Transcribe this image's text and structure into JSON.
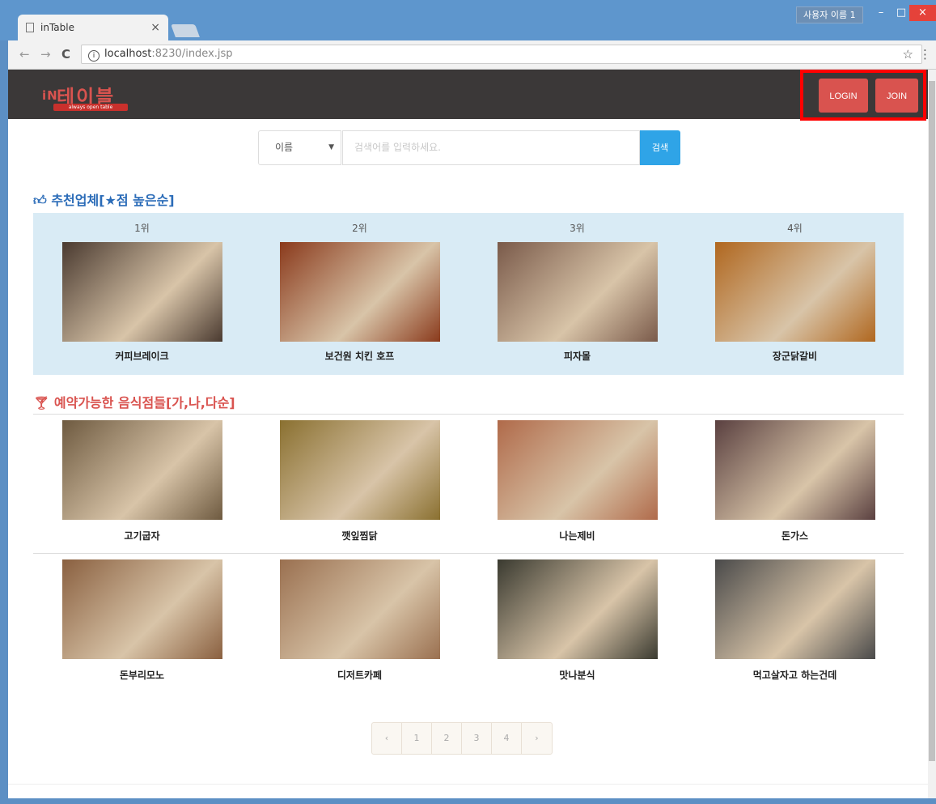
{
  "browser": {
    "tab_title": "inTable",
    "tab_close": "×",
    "user_badge": "사용자 이름 1",
    "win_min": "–",
    "win_max": "□",
    "win_close": "×",
    "url_host": "localhost",
    "url_rest": ":8230/index.jsp",
    "back": "←",
    "forward": "→",
    "reload": "C",
    "star": "☆",
    "menu": "⋮"
  },
  "header": {
    "logo_small": "iN",
    "logo_big": "테이블",
    "logo_tagline": "always open table",
    "login_label": "LOGIN",
    "join_label": "JOIN"
  },
  "search": {
    "select_value": "이름",
    "placeholder": "검색어를 입력하세요.",
    "button_label": "검색"
  },
  "recommended": {
    "title": "추천업체[★점 높은순]",
    "items": [
      {
        "rank": "1위",
        "name": "커피브레이크",
        "color": "#4a3a30"
      },
      {
        "rank": "2위",
        "name": "보건원 치킨 호프",
        "color": "#8a3a1c"
      },
      {
        "rank": "3위",
        "name": "피자몰",
        "color": "#7a5a4a"
      },
      {
        "rank": "4위",
        "name": "장군닭갈비",
        "color": "#b0671f"
      }
    ]
  },
  "reservable": {
    "title": "예약가능한 음식점들[가,나,다순]",
    "row1": [
      {
        "name": "고기굽자",
        "color": "#6e5a40"
      },
      {
        "name": "깻잎찜닭",
        "color": "#8a7030"
      },
      {
        "name": "나는제비",
        "color": "#b06a4a"
      },
      {
        "name": "돈가스",
        "color": "#5a4040"
      }
    ],
    "row2": [
      {
        "name": "돈부리모노",
        "color": "#8a6040"
      },
      {
        "name": "디저트카페",
        "color": "#9a7050"
      },
      {
        "name": "맛나분식",
        "color": "#3a3a30"
      },
      {
        "name": "먹고살자고 하는건데",
        "color": "#4a4a4a"
      }
    ]
  },
  "pagination": {
    "prev": "‹",
    "pages": [
      "1",
      "2",
      "3",
      "4"
    ],
    "next": "›"
  }
}
